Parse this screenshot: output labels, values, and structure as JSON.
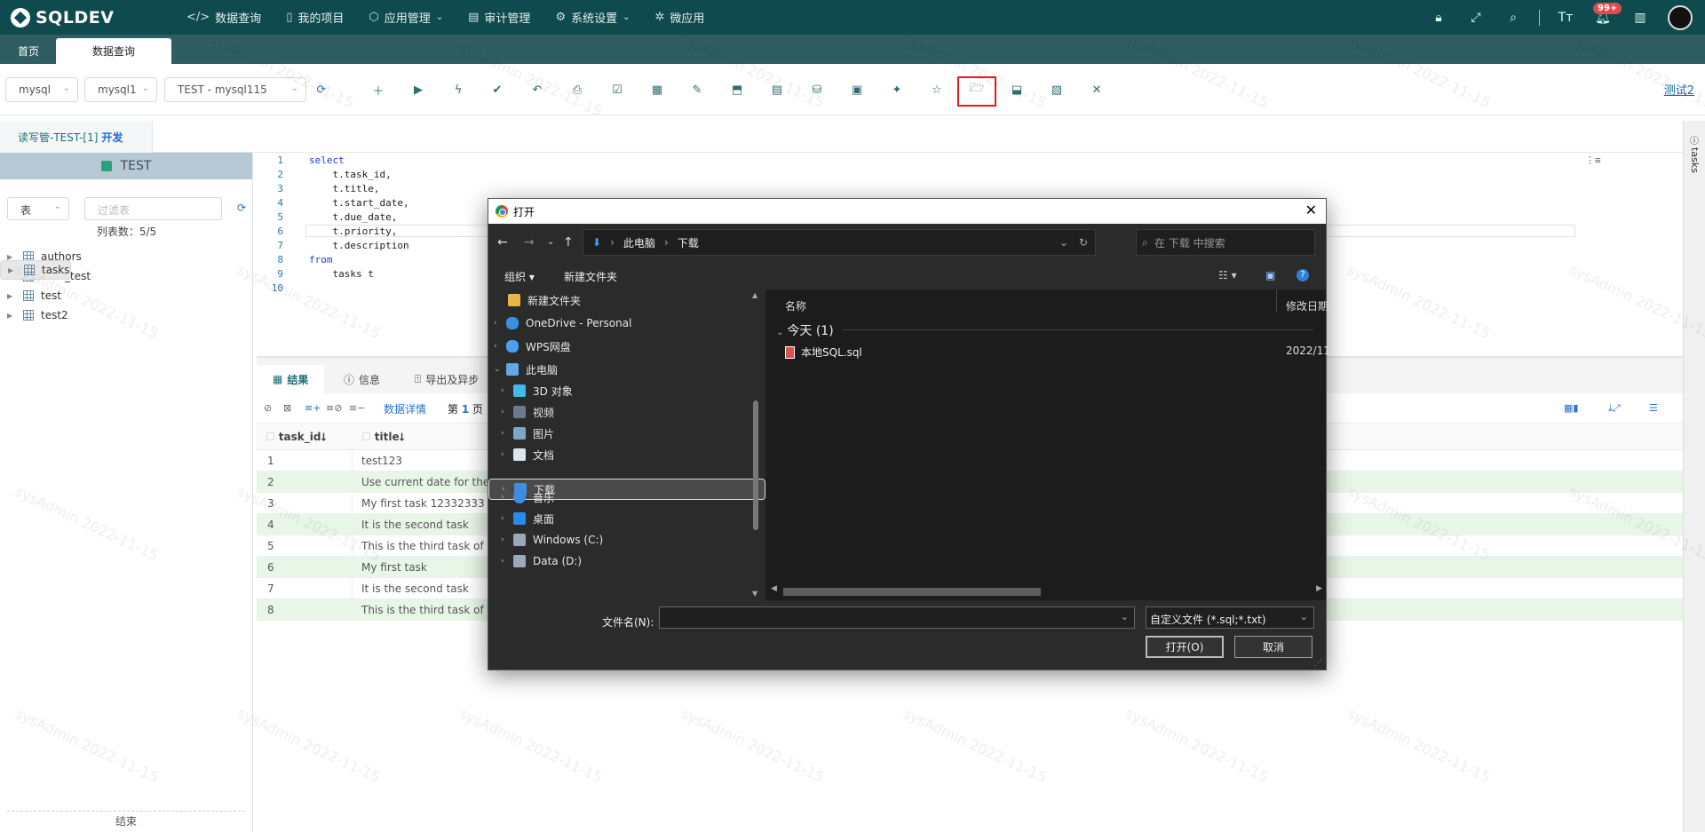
{
  "app": {
    "logo": "SQLDEV"
  },
  "nav": [
    {
      "label": "数据查询",
      "icon": "code-icon"
    },
    {
      "label": "我的项目",
      "icon": "project-icon"
    },
    {
      "label": "应用管理",
      "icon": "cube-icon",
      "dropdown": true
    },
    {
      "label": "审计管理",
      "icon": "audit-icon"
    },
    {
      "label": "系统设置",
      "icon": "gear-icon",
      "dropdown": true
    },
    {
      "label": "微应用",
      "icon": "micro-app-icon"
    }
  ],
  "header": {
    "notification_badge": "99+"
  },
  "tabs": {
    "home": "首页",
    "query": "数据查询"
  },
  "toolbar": {
    "db_type": "mysql",
    "connection": "mysql1",
    "database": "TEST - mysql115",
    "user_link": "测试2"
  },
  "subtab": {
    "label": "读写管-TEST-[1]",
    "env": "开发"
  },
  "sidebar": {
    "db_name": "TEST",
    "object_type": "表",
    "filter_placeholder": "过滤表",
    "count_label": "列表数：5/5",
    "tables": [
      "authors",
      "date_test",
      "tasks",
      "test",
      "test2"
    ],
    "footer": "结束"
  },
  "editor": {
    "line_numbers": [
      "1",
      "2",
      "3",
      "4",
      "5",
      "6",
      "7",
      "8",
      "9",
      "10"
    ],
    "lines": [
      "select",
      "    t.task_id,",
      "    t.title,",
      "    t.start_date,",
      "    t.due_date,",
      "    t.priority,",
      "    t.description",
      "from",
      "    tasks t",
      ""
    ]
  },
  "results": {
    "tabs": [
      "结果",
      "信息",
      "导出及异步"
    ],
    "data_detail_link": "数据详情",
    "page_prefix": "第",
    "page_number": "1",
    "page_suffix": "页",
    "columns": [
      "task_id",
      "title"
    ],
    "rows": [
      [
        "1",
        "test123"
      ],
      [
        "2",
        "Use current date for the"
      ],
      [
        "3",
        "My first task 12332333"
      ],
      [
        "4",
        "It is the second task"
      ],
      [
        "5",
        "This is the third task of th"
      ],
      [
        "6",
        "My first task"
      ],
      [
        "7",
        "It is the second task"
      ],
      [
        "8",
        "This is the third task of th"
      ]
    ]
  },
  "side_panel": {
    "label": "tasks"
  },
  "watermark": "sysAdmin 2022-11-15",
  "dialog": {
    "title": "打开",
    "path": [
      "此电脑",
      "下载"
    ],
    "search_placeholder": "在 下载 中搜索",
    "organize": "组织",
    "new_folder": "新建文件夹",
    "nav_items": [
      {
        "label": "新建文件夹",
        "icon": "folder-icon",
        "expand": false
      },
      {
        "label": "OneDrive - Personal",
        "icon": "cloud-icon",
        "expand": true
      },
      {
        "label": "WPS网盘",
        "icon": "cloud-icon",
        "expand": true
      },
      {
        "label": "此电脑",
        "icon": "computer-icon",
        "expand": true,
        "open": true
      },
      {
        "label": "3D 对象",
        "icon": "cube-3d-icon",
        "expand": true,
        "indent": true
      },
      {
        "label": "视频",
        "icon": "video-icon",
        "expand": true,
        "indent": true
      },
      {
        "label": "图片",
        "icon": "image-icon",
        "expand": true,
        "indent": true
      },
      {
        "label": "文档",
        "icon": "document-icon",
        "expand": true,
        "indent": true
      },
      {
        "label": "下载",
        "icon": "download-icon",
        "expand": true,
        "indent": true,
        "selected": true
      },
      {
        "label": "音乐",
        "icon": "music-icon",
        "expand": true,
        "indent": true
      },
      {
        "label": "桌面",
        "icon": "desktop-icon",
        "expand": true,
        "indent": true
      },
      {
        "label": "Windows (C:)",
        "icon": "drive-icon",
        "expand": true,
        "indent": true
      },
      {
        "label": "Data (D:)",
        "icon": "drive-icon",
        "expand": true,
        "indent": true
      }
    ],
    "col_name": "名称",
    "col_date": "修改日期",
    "group": "今天 (1)",
    "file_name": "本地SQL.sql",
    "file_date": "2022/11",
    "filename_label": "文件名(N):",
    "filename_value": "",
    "file_type": "自定义文件 (*.sql;*.txt)",
    "open_button": "打开(O)",
    "cancel_button": "取消"
  }
}
